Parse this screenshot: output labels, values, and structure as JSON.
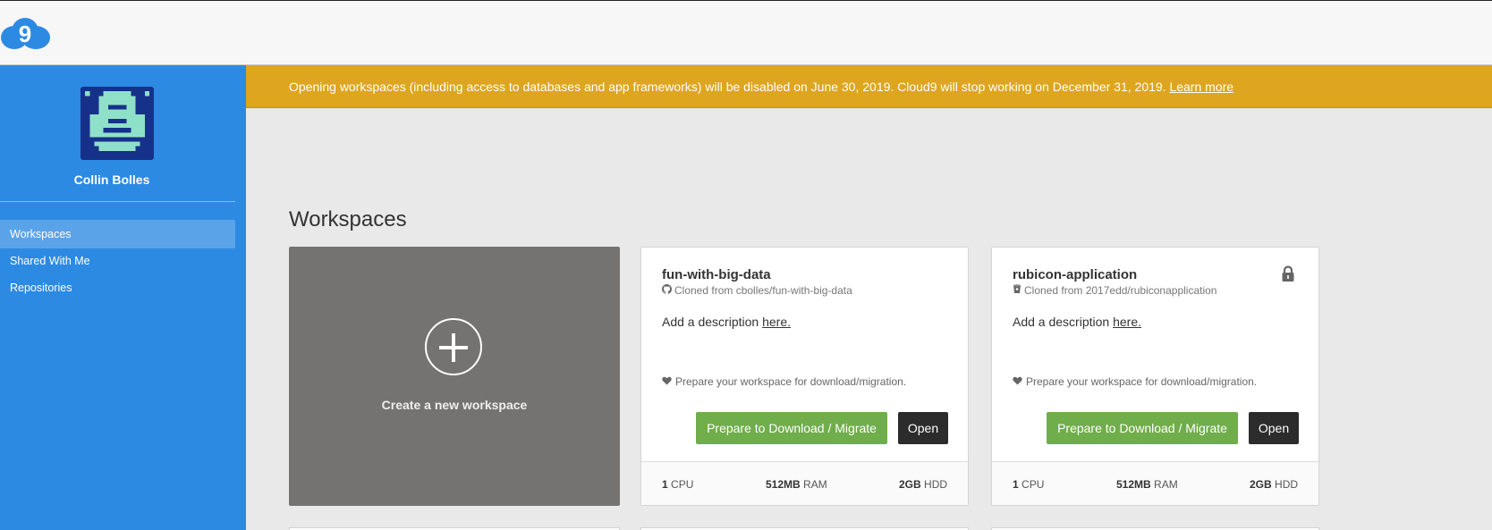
{
  "app": {
    "logo_icon": "cloud9-logo-icon",
    "brand_color": "#2d8ae3"
  },
  "sidebar": {
    "user_name": "Collin Bolles",
    "avatar_icon": "pixel-avatar-icon",
    "items": [
      {
        "label": "Workspaces",
        "active": true
      },
      {
        "label": "Shared With Me",
        "active": false
      },
      {
        "label": "Repositories",
        "active": false
      }
    ]
  },
  "banner": {
    "message": "Opening workspaces (including access to databases and app frameworks) will be disabled on June 30, 2019. Cloud9 will stop working on December 31, 2019. ",
    "link": "Learn more",
    "color": "#dea51f"
  },
  "main": {
    "title": "Workspaces",
    "create_label": "Create a new workspace",
    "workspaces": [
      {
        "name": "fun-with-big-data",
        "source_icon": "github-icon",
        "source": "Cloned from cbolles/fun-with-big-data",
        "desc_prefix": "Add a description ",
        "desc_link": "here.",
        "prep_note": "Prepare your workspace for download/migration.",
        "primary_btn": "Prepare to Download / Migrate",
        "open_btn": "Open",
        "locked": false,
        "cpu_value": "1",
        "cpu_unit": "CPU",
        "ram_value": "512MB",
        "ram_unit": "RAM",
        "hdd_value": "2GB",
        "hdd_unit": "HDD"
      },
      {
        "name": "rubicon-application",
        "source_icon": "bitbucket-icon",
        "source": "Cloned from 2017edd/rubiconapplication",
        "desc_prefix": "Add a description ",
        "desc_link": "here.",
        "prep_note": "Prepare your workspace for download/migration.",
        "primary_btn": "Prepare to Download / Migrate",
        "open_btn": "Open",
        "locked": true,
        "cpu_value": "1",
        "cpu_unit": "CPU",
        "ram_value": "512MB",
        "ram_unit": "RAM",
        "hdd_value": "2GB",
        "hdd_unit": "HDD"
      }
    ]
  }
}
